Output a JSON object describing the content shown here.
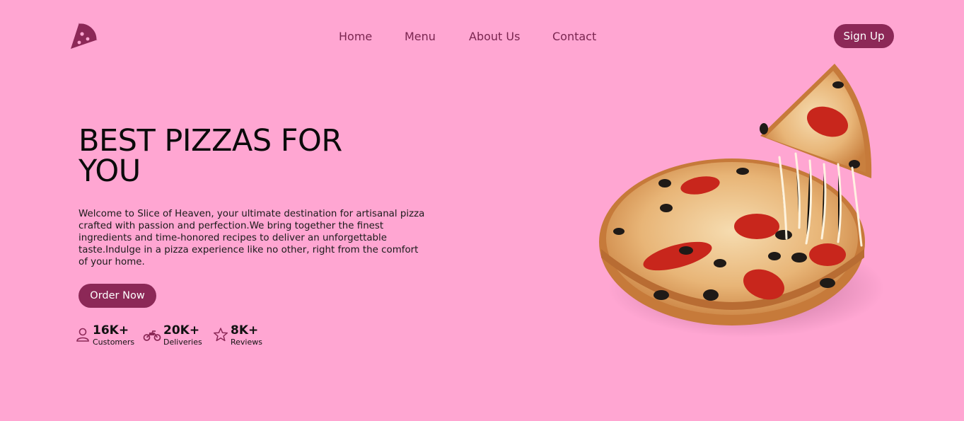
{
  "header": {
    "logo_icon": "pizza-slice-icon",
    "nav": [
      "Home",
      "Menu",
      "About Us",
      "Contact"
    ],
    "signup_label": "Sign Up"
  },
  "hero": {
    "title": "BEST PIZZAS FOR YOU",
    "description": "Welcome to Slice of Heaven, your ultimate destination for artisanal pizza crafted with passion and perfection.We bring together the finest ingredients and time-honored recipes to deliver an unforgettable taste.Indulge in a pizza experience like no other, right from the comfort of your home.",
    "cta_label": "Order Now"
  },
  "stats": [
    {
      "icon": "user-icon",
      "value": "16K+",
      "label": "Customers"
    },
    {
      "icon": "motorbike-icon",
      "value": "20K+",
      "label": "Deliveries"
    },
    {
      "icon": "star-icon",
      "value": "8K+",
      "label": "Reviews"
    }
  ],
  "colors": {
    "background": "#ffa6d2",
    "accent": "#8c2857",
    "nav_text": "#7a2550"
  },
  "hero_image": "pizza-with-lifted-slice"
}
